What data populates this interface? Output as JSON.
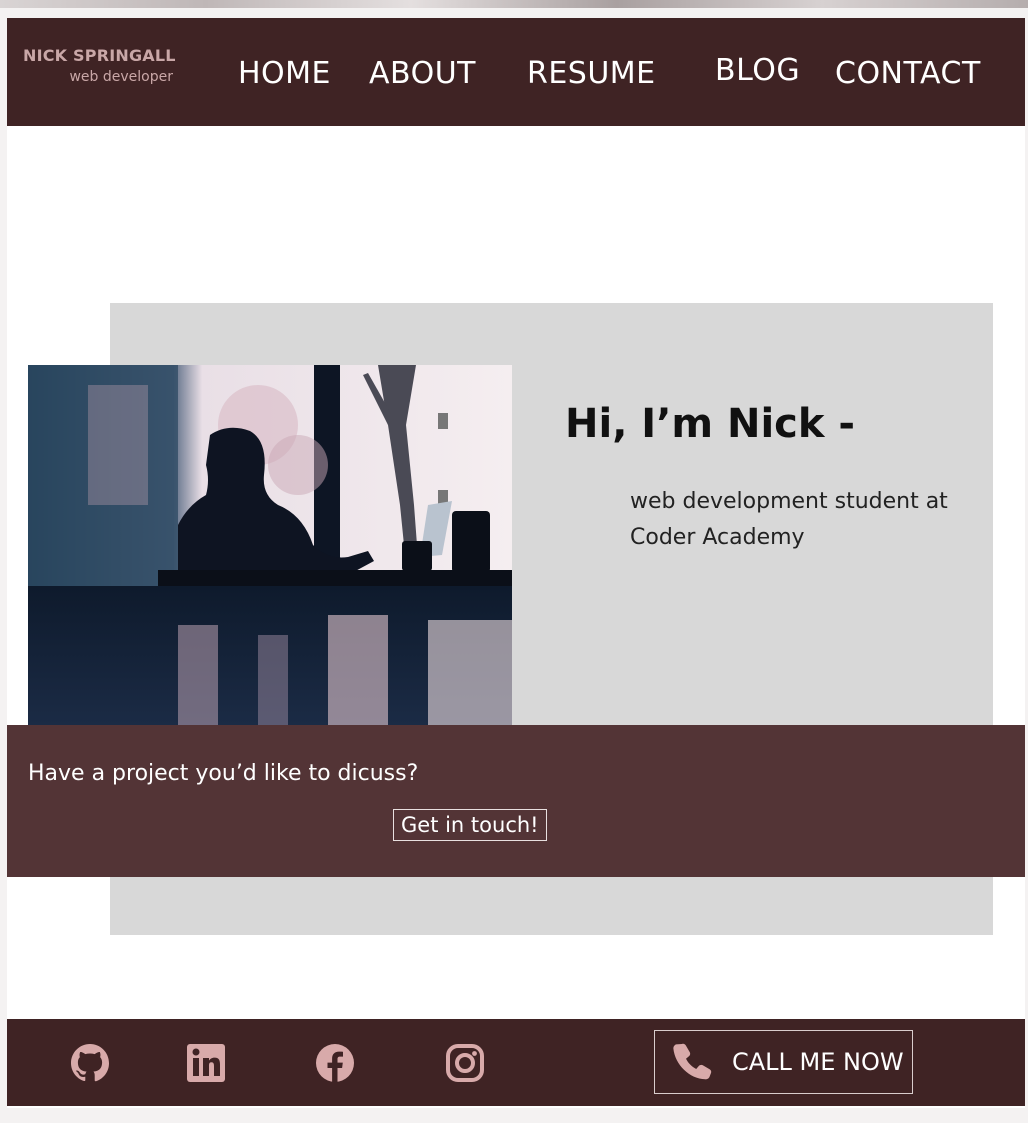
{
  "header": {
    "brand_name": "NICK SPRINGALL",
    "brand_subtitle": "web developer",
    "nav": [
      {
        "label": "HOME"
      },
      {
        "label": "ABOUT"
      },
      {
        "label": "RESUME"
      },
      {
        "label": "BLOG"
      },
      {
        "label": "CONTACT"
      }
    ]
  },
  "hero": {
    "greeting": "Hi, I’m Nick -",
    "tagline": "web development student at Coder Academy",
    "photo_icon": "person-at-laptop-photo"
  },
  "cta": {
    "text": "Have a project you’d like to dicuss?",
    "button_label": "Get in touch!"
  },
  "footer": {
    "social_icons": [
      "github-icon",
      "linkedin-icon",
      "facebook-icon",
      "instagram-icon"
    ],
    "call_label": "CALL ME NOW",
    "call_icon": "phone-icon"
  },
  "colors": {
    "header_bg": "#3f2324",
    "cta_bg": "#533436",
    "hero_panel": "#d8d8d8",
    "accent_text": "#c9a7a7"
  }
}
